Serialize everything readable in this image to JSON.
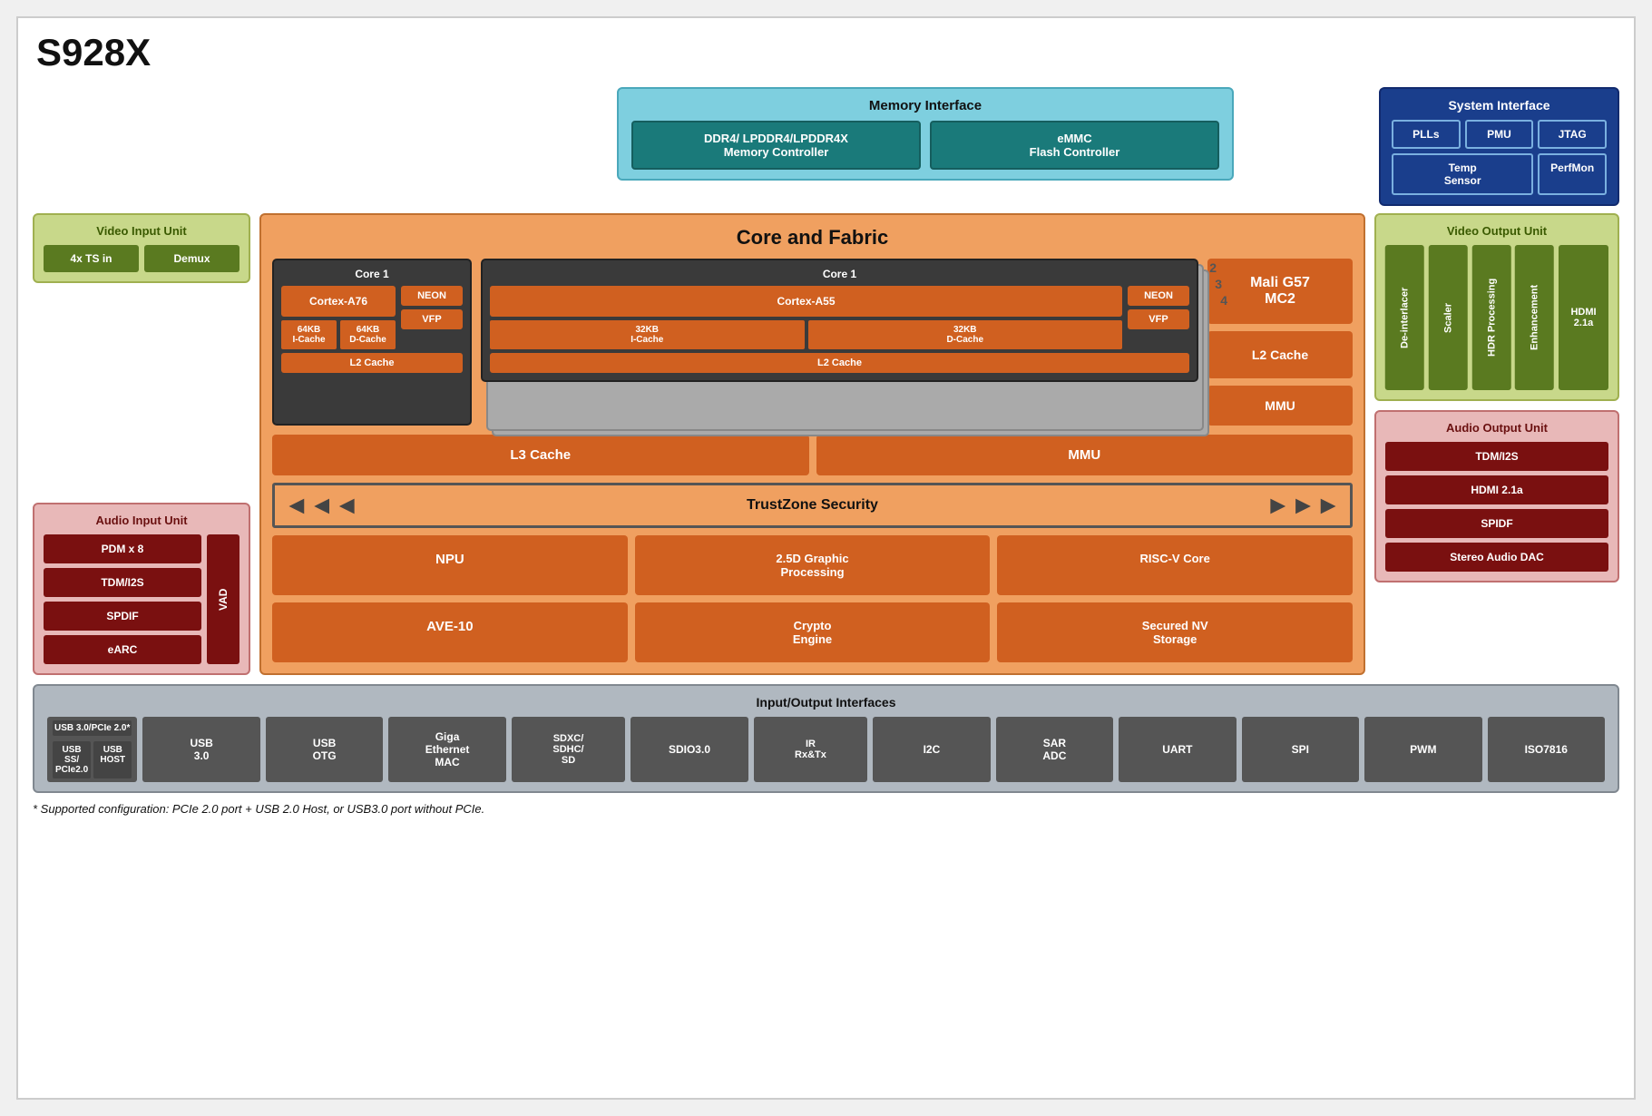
{
  "title": "S928X",
  "memory_interface": {
    "title": "Memory Interface",
    "ddr": "DDR4/ LPDDR4/LPDDR4X\nMemory Controller",
    "emmc": "eMMC\nFlash Controller"
  },
  "system_interface": {
    "title": "System Interface",
    "plls": "PLLs",
    "pmu": "PMU",
    "jtag": "JTAG",
    "temp_sensor": "Temp\nSensor",
    "perfmon": "PerfMon"
  },
  "video_input": {
    "title": "Video Input Unit",
    "ts_in": "4x TS in",
    "demux": "Demux"
  },
  "core_fabric": {
    "title": "Core and Fabric",
    "core1_a76": {
      "label": "Core 1",
      "cortex": "Cortex-A76",
      "neon": "NEON",
      "vfp": "VFP",
      "icache": "64KB\nI-Cache",
      "dcache": "64KB\nD-Cache",
      "l2": "L2 Cache"
    },
    "core1_a55": {
      "label": "Core 1",
      "cortex": "Cortex-A55",
      "neon": "NEON",
      "vfp": "VFP",
      "icache": "32KB\nI-Cache",
      "dcache": "32KB\nD-Cache",
      "l2": "L2 Cache"
    },
    "core_numbers": [
      "2",
      "3",
      "4"
    ],
    "mali": "Mali G57\nMC2",
    "l2_cache": "L2 Cache",
    "mmu_right": "MMU",
    "l3": "L3 Cache",
    "mmu_main": "MMU",
    "trustzone": "TrustZone Security",
    "npu": "NPU",
    "graphic": "2.5D Graphic\nProcessing",
    "riscv": "RISC-V Core",
    "ave": "AVE-10",
    "crypto": "Crypto\nEngine",
    "secured": "Secured NV\nStorage"
  },
  "audio_input": {
    "title": "Audio Input Unit",
    "pdm": "PDM x 8",
    "tdm": "TDM/I2S",
    "spdif": "SPDIF",
    "earc": "eARC",
    "vad": "VAD"
  },
  "video_output": {
    "title": "Video Output Unit",
    "de_interlacer": "De-interlacer",
    "scaler": "Scaler",
    "hdr": "HDR Processing",
    "enhancement": "Enhancement",
    "hdmi": "HDMI 2.1a"
  },
  "audio_output": {
    "title": "Audio Output Unit",
    "tdm": "TDM/I2S",
    "hdmi": "HDMI 2.1a",
    "spidf": "SPIDF",
    "stereo": "Stereo Audio DAC"
  },
  "io": {
    "title": "Input/Output Interfaces",
    "usb_pcie_top": "USB  3.0/PCIe 2.0*",
    "usb_ss": "USB SS/\nPCIe2.0",
    "usb_host": "USB\nHOST",
    "usb_30": "USB\n3.0",
    "usb_otg": "USB\nOTG",
    "giga": "Giga\nEthernet\nMAC",
    "sdxc": "SDXC/\nSDHC/\nSD",
    "sdio": "SDIO3.0",
    "ir": "IR\nRx&Tx",
    "i2c": "I2C",
    "sar_adc": "SAR\nADC",
    "uart": "UART",
    "spi": "SPI",
    "pwm": "PWM",
    "iso7816": "ISO7816"
  },
  "footnote": "* Supported configuration: PCIe 2.0 port + USB 2.0 Host, or USB3.0 port without PCIe."
}
